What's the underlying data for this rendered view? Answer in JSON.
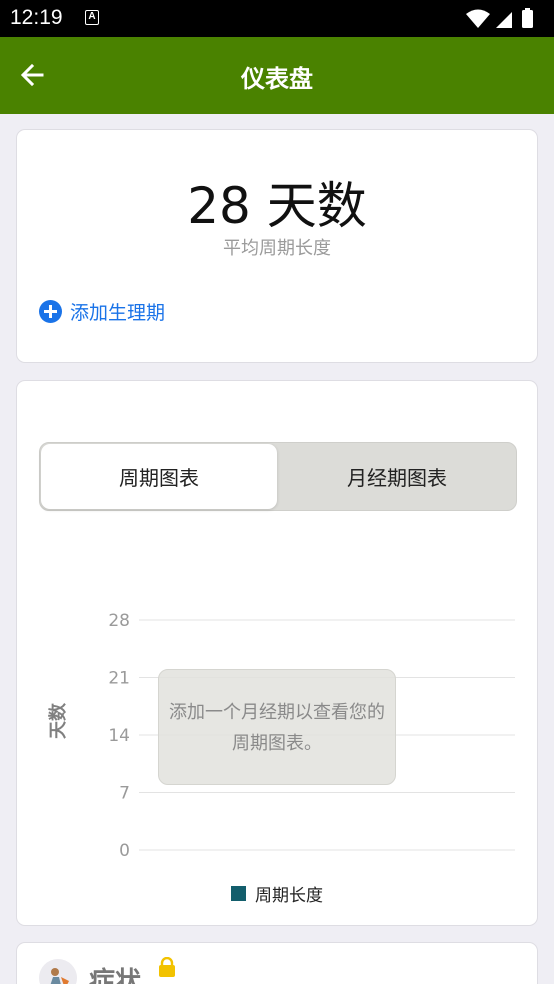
{
  "status_bar": {
    "time": "12:19",
    "notification_letter": "A"
  },
  "app_bar": {
    "title": "仪表盘"
  },
  "summary_card": {
    "average_cycle_value": "28 天数",
    "average_cycle_label": "平均周期长度",
    "add_period_label": "添加生理期"
  },
  "chart_card": {
    "tabs": [
      {
        "label": "周期图表",
        "selected": true
      },
      {
        "label": "月经期图表",
        "selected": false
      }
    ],
    "empty_message": "添加一个月经期以查看您的周期图表。"
  },
  "chart_data": {
    "type": "bar",
    "categories": [],
    "series": [
      {
        "name": "周期长度",
        "values": []
      }
    ],
    "ylabel": "天数",
    "ylim": [
      0,
      28
    ],
    "yticks": [
      0,
      7,
      14,
      21,
      28
    ],
    "grid": true,
    "legend": "bottom",
    "series_color": "#135e6c"
  },
  "symptoms_card": {
    "title": "症状",
    "locked": true
  },
  "colors": {
    "app_bar": "#4a8200",
    "accent": "#1a73e8",
    "series": "#135e6c",
    "lock": "#f2c200"
  }
}
